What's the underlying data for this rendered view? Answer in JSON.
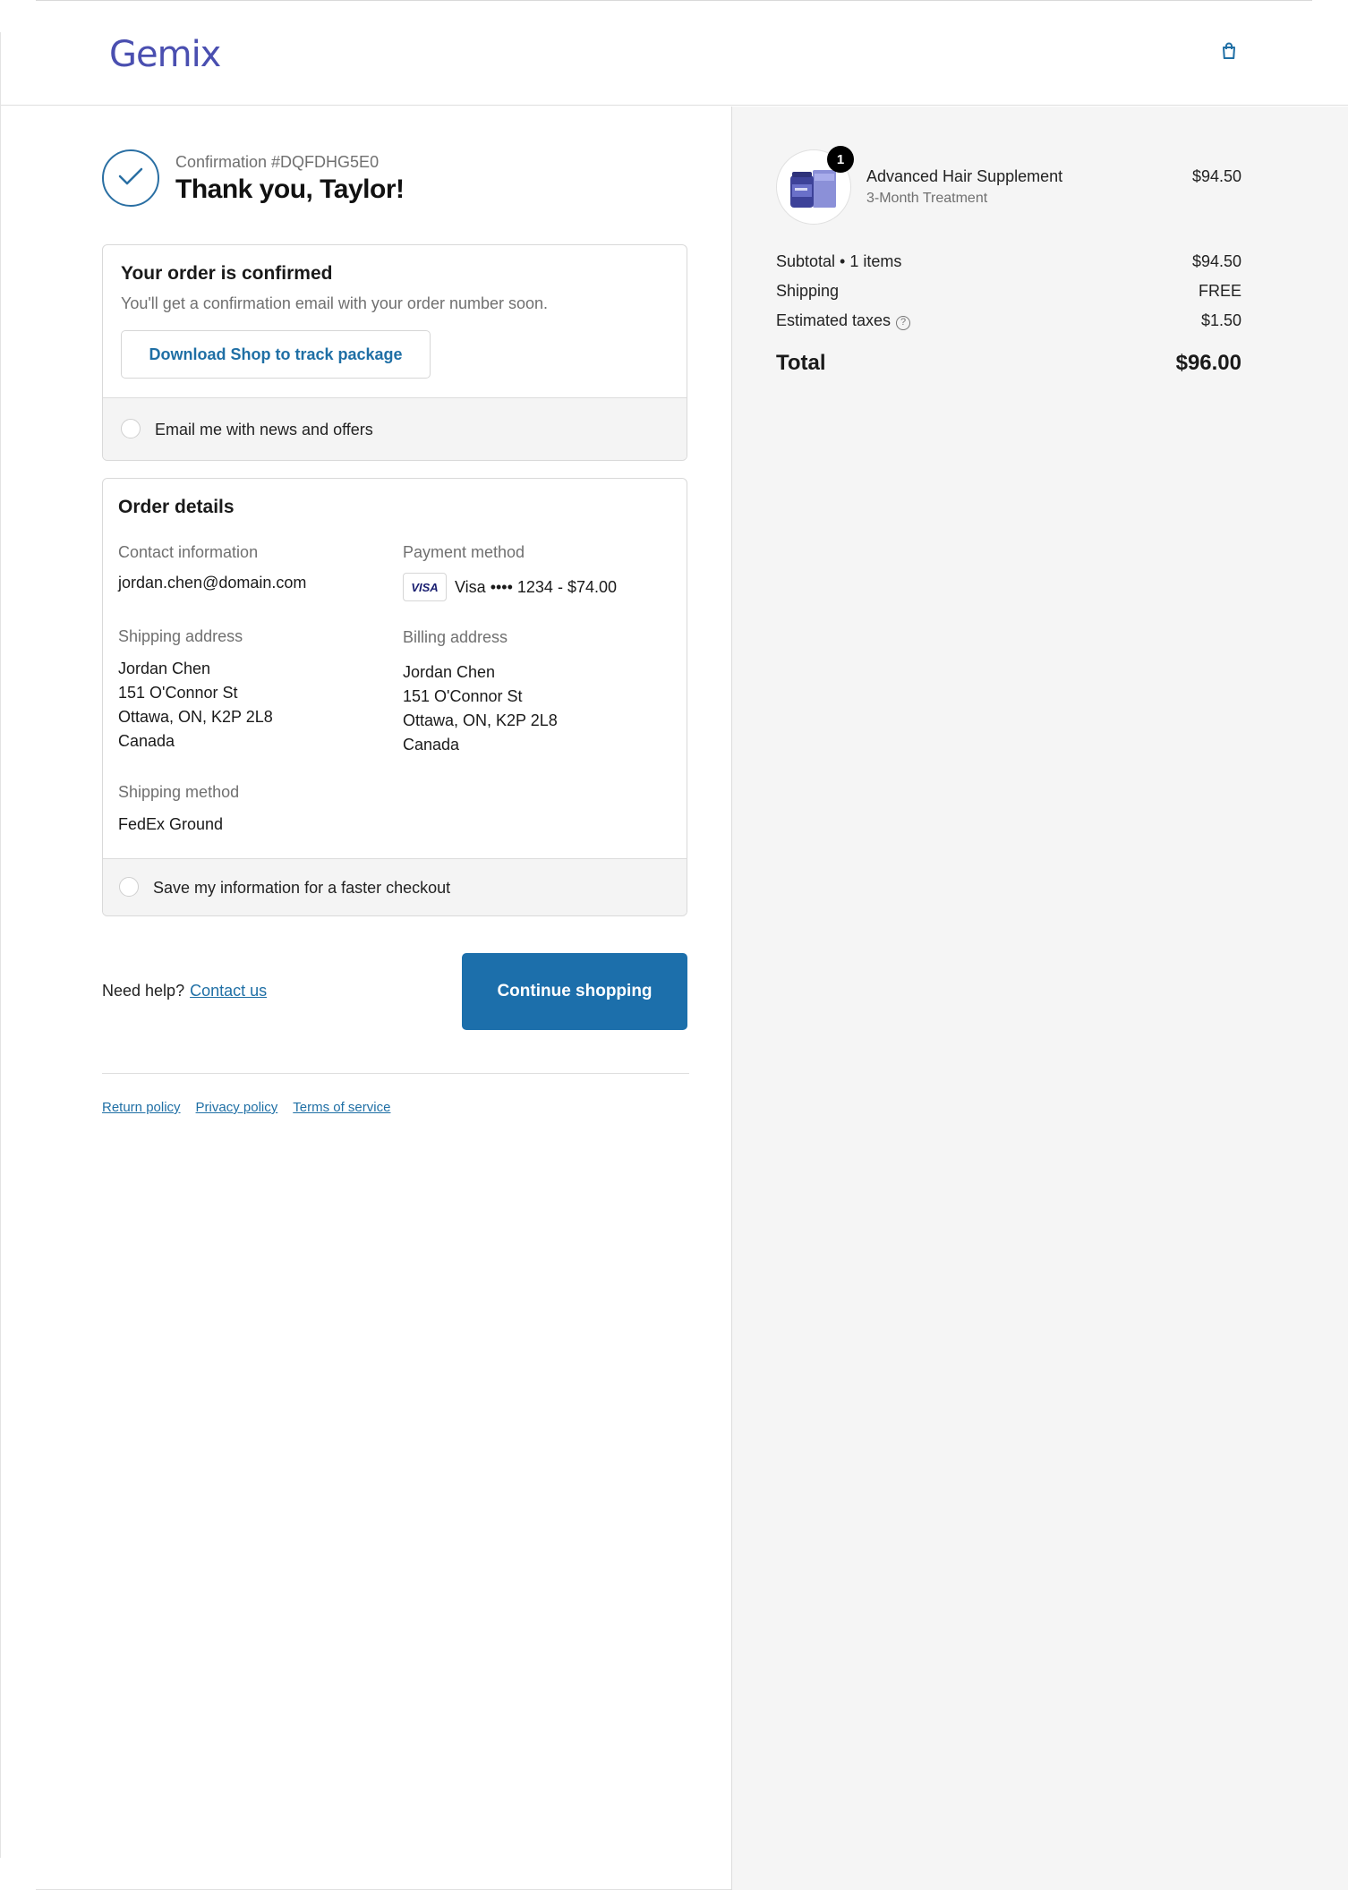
{
  "header": {
    "logo": "Gemix"
  },
  "confirmation": {
    "number": "Confirmation #DQFDHG5E0",
    "thanks": "Thank you, Taylor!"
  },
  "order_confirmed": {
    "title": "Your order is confirmed",
    "subtitle": "You'll get a confirmation email with your order number soon.",
    "download_button": "Download Shop to track package",
    "email_opt_in": "Email me with news and offers"
  },
  "order_details": {
    "title": "Order details",
    "contact_label": "Contact information",
    "contact_value": "jordan.chen@domain.com",
    "payment_label": "Payment method",
    "card_brand": "VISA",
    "payment_value": "Visa •••• 1234 - $74.00",
    "shipping_address_label": "Shipping address",
    "shipping_address": [
      "Jordan Chen",
      "151 O'Connor St",
      "Ottawa, ON, K2P 2L8",
      "Canada"
    ],
    "billing_address_label": "Billing address",
    "billing_address": [
      "Jordan Chen",
      "151 O'Connor St",
      "Ottawa, ON, K2P 2L8",
      "Canada"
    ],
    "shipping_method_label": "Shipping method",
    "shipping_method": "FedEx Ground",
    "save_info": "Save my information for a faster checkout"
  },
  "footer": {
    "need_help": "Need help?",
    "contact_link": "Contact us",
    "continue_button": "Continue shopping",
    "links": [
      "Return policy",
      "Privacy policy",
      "Terms of service"
    ]
  },
  "summary": {
    "item": {
      "name": "Advanced Hair Supplement",
      "variant": "3-Month Treatment",
      "price": "$94.50",
      "quantity": "1"
    },
    "subtotal_label": "Subtotal • 1 items",
    "subtotal_value": "$94.50",
    "shipping_label": "Shipping",
    "shipping_value": "FREE",
    "taxes_label": "Estimated taxes",
    "taxes_value": "$1.50",
    "total_label": "Total",
    "total_value": "$96.00"
  },
  "colors": {
    "accent": "#1c6fab",
    "logo": "#4a4fb0",
    "summary_bg": "#f5f5f5"
  },
  "icons": [
    "shopping-bag-icon",
    "checkmark-icon",
    "help-circle-icon",
    "radio-icon"
  ]
}
